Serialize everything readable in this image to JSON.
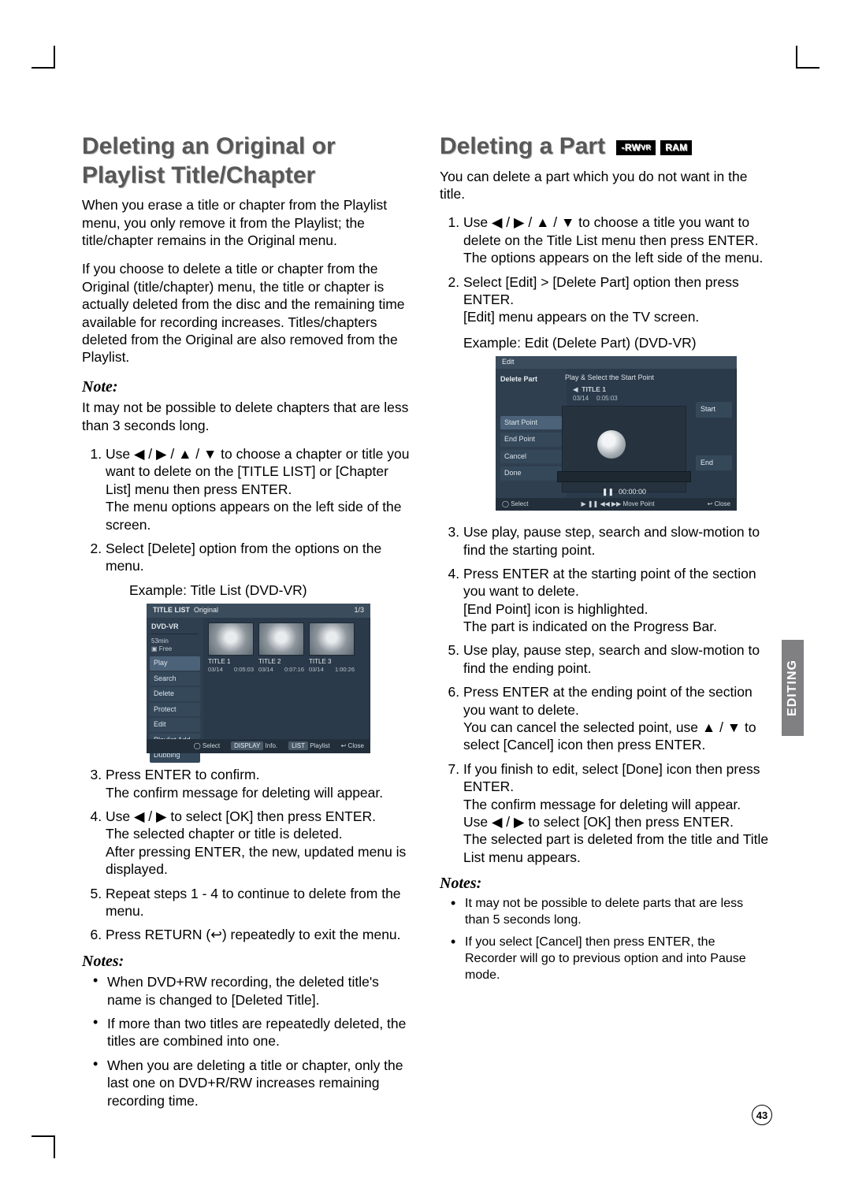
{
  "page_number": "43",
  "side_tab": "EDITING",
  "left": {
    "heading": "Deleting an Original or Playlist Title/Chapter",
    "p1": "When you erase a title or chapter from the Playlist menu, you only remove it from the Playlist; the title/chapter remains in the Original menu.",
    "p2": "If you choose to delete a title or chapter from the Original (title/chapter) menu, the title or chapter is actually deleted from the disc and the remaining time available for recording increases. Titles/chapters deleted from the Original are also removed from the Playlist.",
    "note_hd": "Note:",
    "note_p": "It may not be possible to delete chapters that are less than 3 seconds long.",
    "step1a": "Use ◀ / ▶ / ▲ / ▼ to choose a chapter or title you want to delete on the [TITLE LIST] or [Chapter List] menu then press ENTER.",
    "step1b": "The menu options appears on the left side of the screen.",
    "step2": "Select [Delete] option from the options on the menu.",
    "example_label": "Example: Title List (DVD-VR)",
    "shot1": {
      "top_left": "TITLE LIST",
      "top_left2": "Original",
      "top_right": "1/3",
      "info_disc": "DVD-VR",
      "info_time": "53min",
      "info_free": "Free",
      "menu": [
        "Play",
        "Search",
        "Delete",
        "Protect",
        "Edit",
        "Playlist Add",
        "Dubbing"
      ],
      "thumbs": [
        {
          "t": "TITLE 1",
          "d": "03/14",
          "len": "0:05:03"
        },
        {
          "t": "TITLE 2",
          "d": "03/14",
          "len": "0:07:16"
        },
        {
          "t": "TITLE 3",
          "d": "03/14",
          "len": "1:00:26"
        }
      ],
      "bottom": {
        "select": "Select",
        "info_chip": "DISPLAY",
        "info": "Info.",
        "playlist_chip": "LIST",
        "playlist": "Playlist",
        "close": "Close"
      }
    },
    "step3a": "Press ENTER to confirm.",
    "step3b": "The confirm message for deleting will appear.",
    "step4a": "Use ◀ / ▶ to select [OK] then press ENTER.",
    "step4b": "The selected chapter or title is deleted.",
    "step4c": "After pressing ENTER, the new, updated menu is displayed.",
    "step5": "Repeat steps 1 - 4 to continue to delete from the menu.",
    "step6": "Press RETURN (↩) repeatedly to exit the menu.",
    "notes_hd": "Notes:",
    "notes": [
      "When DVD+RW recording, the deleted title's name is changed to [Deleted Title].",
      "If more than two titles are repeatedly deleted, the titles are combined into one.",
      "When you are deleting a title or chapter, only the last one on DVD+R/RW increases remaining recording time."
    ]
  },
  "right": {
    "heading": "Deleting a Part",
    "badge1a": "-RW",
    "badge1b": "VR",
    "badge2": "RAM",
    "p1": "You can delete a part which you do not want in the title.",
    "step1a": "Use ◀ / ▶ / ▲ / ▼ to choose a title you want to delete on the Title List menu then press ENTER.",
    "step1b": "The options appears on the left side of the menu.",
    "step2a": "Select [Edit] > [Delete Part] option then press ENTER.",
    "step2b": "[Edit] menu appears on the TV screen.",
    "example_label": "Example: Edit (Delete Part) (DVD-VR)",
    "shot2": {
      "top": "Edit",
      "left_label": "Delete Part",
      "left_items": [
        "Start Point",
        "End Point",
        "Cancel",
        "Done"
      ],
      "hint": "Play & Select the Start Point",
      "title": "TITLE 1",
      "date": "03/14",
      "len": "0:05:03",
      "time": "00:00:00",
      "side_btns": [
        "Start",
        "End"
      ],
      "bottom_select": "Select",
      "bottom_move": "▶ ❚❚ ◀◀ ▶▶ Move Point",
      "bottom_close": "Close"
    },
    "step3": "Use play, pause step, search and slow-motion to find the starting point.",
    "step4a": "Press ENTER at the starting point of the section you want to delete.",
    "step4b": "[End Point] icon is highlighted.",
    "step4c": "The part is indicated on the Progress Bar.",
    "step5": "Use play, pause step, search and slow-motion to find the ending point.",
    "step6a": "Press ENTER at the ending point of the section you want to delete.",
    "step6b": "You can cancel the selected point, use ▲ / ▼ to select [Cancel] icon then press ENTER.",
    "step7a": "If you finish to edit, select [Done] icon then press ENTER.",
    "step7b": "The confirm message for deleting will appear.",
    "step7c": "Use ◀ / ▶ to select [OK] then press ENTER.",
    "step7d": "The selected part is deleted from the title and Title List menu appears.",
    "notes_hd": "Notes:",
    "notes": [
      "It may not be possible to delete parts that are less than 5 seconds long.",
      "If you select [Cancel] then press ENTER, the Recorder will go to previous option and into Pause mode."
    ]
  }
}
